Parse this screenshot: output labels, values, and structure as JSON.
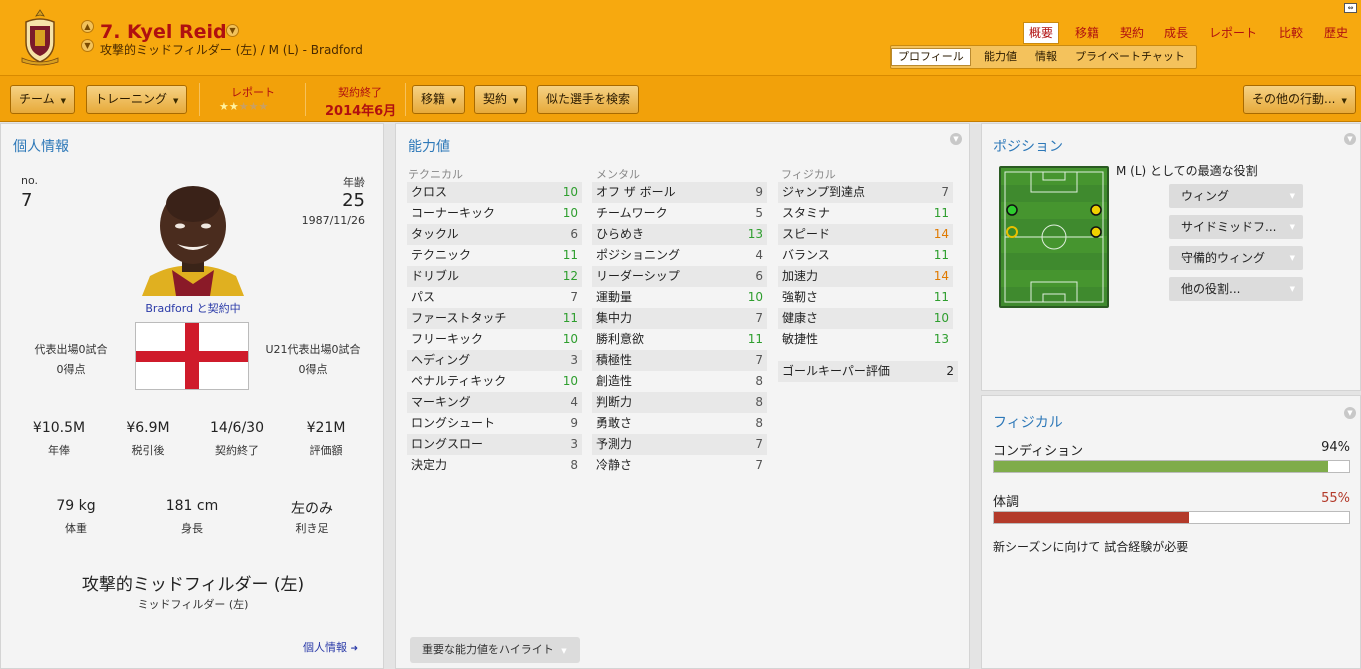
{
  "header": {
    "title": "7. Kyel Reid",
    "subtitle": "攻撃的ミッドフィルダー (左) / M (L) - Bradford",
    "nav_tabs": [
      "概要",
      "移籍",
      "契約",
      "成長",
      "レポート",
      "比較",
      "歴史"
    ],
    "subnav_tabs": [
      "プロフィール",
      "能力値",
      "情報",
      "プライベートチャット"
    ]
  },
  "toolbar": {
    "team": "チーム",
    "training": "トレーニング",
    "report_label": "レポート",
    "report_stars": 2,
    "contract_label": "契約終了",
    "contract_value": "2014年6月",
    "transfer": "移籍",
    "contract": "契約",
    "similar": "似た選手を検索",
    "other": "その他の行動..."
  },
  "personal": {
    "title": "個人情報",
    "no_label": "no.",
    "no_value": "7",
    "age_label": "年齢",
    "age_value": "25",
    "dob": "1987/11/26",
    "club_status": "Bradford と契約中",
    "caps_label": "代表出場0試合",
    "caps_goals": "0得点",
    "u21_label": "U21代表出場0試合",
    "u21_goals": "0得点",
    "wage_value": "¥10.5M",
    "wage_label": "年俸",
    "net_value": "¥6.9M",
    "net_label": "税引後",
    "expiry_value": "14/6/30",
    "expiry_label": "契約終了",
    "valuation_value": "¥21M",
    "valuation_label": "評価額",
    "weight_value": "79 kg",
    "weight_label": "体重",
    "height_value": "181 cm",
    "height_label": "身長",
    "foot_value": "左のみ",
    "foot_label": "利き足",
    "position_main": "攻撃的ミッドフィルダー (左)",
    "position_sub": "ミッドフィルダー (左)",
    "more_link": "個人情報"
  },
  "attributes": {
    "title": "能力値",
    "technical_head": "テクニカル",
    "mental_head": "メンタル",
    "physical_head": "フィジカル",
    "technical": [
      {
        "name": "クロス",
        "value": "10",
        "color": "#2e9e2e"
      },
      {
        "name": "コーナーキック",
        "value": "10",
        "color": "#2e9e2e"
      },
      {
        "name": "タックル",
        "value": "6",
        "color": "#555555"
      },
      {
        "name": "テクニック",
        "value": "11",
        "color": "#2e9e2e"
      },
      {
        "name": "ドリブル",
        "value": "12",
        "color": "#2e9e2e"
      },
      {
        "name": "パス",
        "value": "7",
        "color": "#555555"
      },
      {
        "name": "ファーストタッチ",
        "value": "11",
        "color": "#2e9e2e"
      },
      {
        "name": "フリーキック",
        "value": "10",
        "color": "#2e9e2e"
      },
      {
        "name": "ヘディング",
        "value": "3",
        "color": "#555555"
      },
      {
        "name": "ペナルティキック",
        "value": "10",
        "color": "#2e9e2e"
      },
      {
        "name": "マーキング",
        "value": "4",
        "color": "#555555"
      },
      {
        "name": "ロングシュート",
        "value": "9",
        "color": "#555555"
      },
      {
        "name": "ロングスロー",
        "value": "3",
        "color": "#555555"
      },
      {
        "name": "決定力",
        "value": "8",
        "color": "#555555"
      }
    ],
    "mental": [
      {
        "name": "オフ ザ ボール",
        "value": "9",
        "color": "#555555"
      },
      {
        "name": "チームワーク",
        "value": "5",
        "color": "#555555"
      },
      {
        "name": "ひらめき",
        "value": "13",
        "color": "#2e9e2e"
      },
      {
        "name": "ポジショニング",
        "value": "4",
        "color": "#555555"
      },
      {
        "name": "リーダーシップ",
        "value": "6",
        "color": "#555555"
      },
      {
        "name": "運動量",
        "value": "10",
        "color": "#2e9e2e"
      },
      {
        "name": "集中力",
        "value": "7",
        "color": "#555555"
      },
      {
        "name": "勝利意欲",
        "value": "11",
        "color": "#2e9e2e"
      },
      {
        "name": "積極性",
        "value": "7",
        "color": "#555555"
      },
      {
        "name": "創造性",
        "value": "8",
        "color": "#555555"
      },
      {
        "name": "判断力",
        "value": "8",
        "color": "#555555"
      },
      {
        "name": "勇敢さ",
        "value": "8",
        "color": "#555555"
      },
      {
        "name": "予測力",
        "value": "7",
        "color": "#555555"
      },
      {
        "name": "冷静さ",
        "value": "7",
        "color": "#555555"
      }
    ],
    "physical": [
      {
        "name": "ジャンプ到達点",
        "value": "7",
        "color": "#555555"
      },
      {
        "name": "スタミナ",
        "value": "11",
        "color": "#2e9e2e"
      },
      {
        "name": "スピード",
        "value": "14",
        "color": "#e07a00"
      },
      {
        "name": "バランス",
        "value": "11",
        "color": "#2e9e2e"
      },
      {
        "name": "加速力",
        "value": "14",
        "color": "#e07a00"
      },
      {
        "name": "強靭さ",
        "value": "11",
        "color": "#2e9e2e"
      },
      {
        "name": "健康さ",
        "value": "10",
        "color": "#2e9e2e"
      },
      {
        "name": "敏捷性",
        "value": "13",
        "color": "#2e9e2e"
      }
    ],
    "goalkeeper_label": "ゴールキーパー評価",
    "goalkeeper_value": "2",
    "highlight_button": "重要な能力値をハイライト"
  },
  "position": {
    "title": "ポジション",
    "best_role_label": "M (L) としての最適な役割",
    "roles": [
      "ウィング",
      "サイドミッドフ...",
      "守備的ウィング",
      "他の役割..."
    ]
  },
  "physical": {
    "title": "フィジカル",
    "condition_label": "コンディション",
    "condition_value": "94%",
    "condition_fraction": 0.94,
    "condition_color": "#7fac4a",
    "fitness_label": "体調",
    "fitness_value": "55%",
    "fitness_fraction": 0.55,
    "fitness_color": "#b33a2a",
    "note": "新シーズンに向けて 試合経験が必要"
  }
}
